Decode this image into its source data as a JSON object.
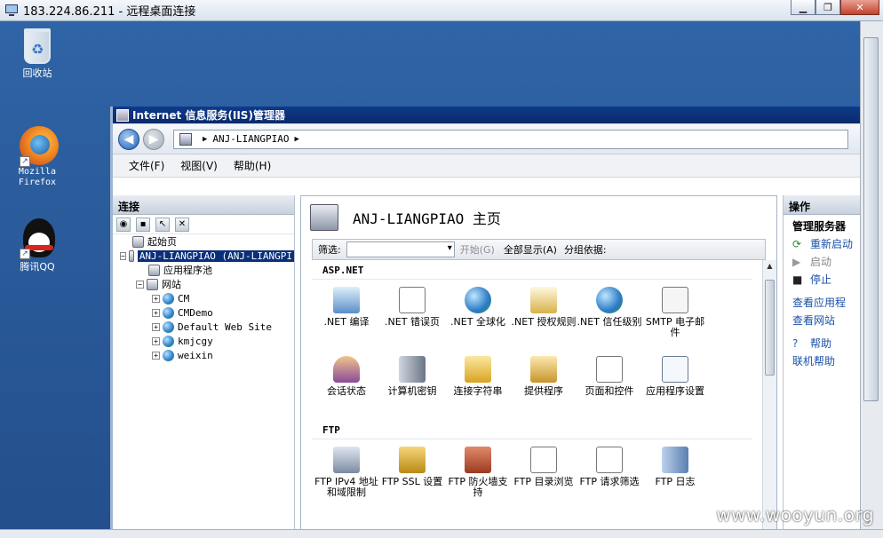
{
  "rdp": {
    "title": "183.224.86.211 - 远程桌面连接"
  },
  "desktop": {
    "icons": [
      {
        "label": "回收站"
      },
      {
        "label": "Mozilla Firefox"
      },
      {
        "label": "腾讯QQ"
      }
    ]
  },
  "iis": {
    "title": "Internet 信息服务(IIS)管理器",
    "address": {
      "server": "ANJ-LIANGPIAO"
    },
    "menu": [
      "文件(F)",
      "视图(V)",
      "帮助(H)"
    ],
    "connections": {
      "header": "连接",
      "tree": [
        {
          "label": "起始页"
        },
        {
          "label": "ANJ-LIANGPIAO (ANJ-LIANGPI"
        },
        {
          "label": "应用程序池"
        },
        {
          "label": "网站"
        },
        {
          "label": "CM"
        },
        {
          "label": "CMDemo"
        },
        {
          "label": "Default Web Site"
        },
        {
          "label": "kmjcgy"
        },
        {
          "label": "weixin"
        }
      ]
    },
    "home": {
      "title": "ANJ-LIANGPIAO 主页",
      "filter": {
        "label": "筛选:",
        "go": "开始(G)",
        "show_all": "全部显示(A)",
        "group_by": "分组依据:"
      },
      "sections": [
        {
          "name": "ASP.NET",
          "items": [
            {
              "label": ".NET 编译",
              "icon": "compile-icon"
            },
            {
              "label": ".NET 错误页",
              "icon": "error-page-icon"
            },
            {
              "label": ".NET 全球化",
              "icon": "globe-icon"
            },
            {
              "label": ".NET 授权规则",
              "icon": "auth-rules-icon"
            },
            {
              "label": ".NET 信任级别",
              "icon": "trust-icon"
            },
            {
              "label": "SMTP 电子邮件",
              "icon": "email-icon"
            },
            {
              "label": "会话状态",
              "icon": "session-icon"
            },
            {
              "label": "计算机密钥",
              "icon": "machine-key-icon"
            },
            {
              "label": "连接字符串",
              "icon": "connection-string-icon"
            },
            {
              "label": "提供程序",
              "icon": "providers-icon"
            },
            {
              "label": "页面和控件",
              "icon": "pages-icon"
            },
            {
              "label": "应用程序设置",
              "icon": "app-settings-icon"
            }
          ]
        },
        {
          "name": "FTP",
          "items": [
            {
              "label": "FTP IPv4 地址和域限制",
              "icon": "ftp-ip-icon"
            },
            {
              "label": "FTP SSL 设置",
              "icon": "ftp-ssl-icon"
            },
            {
              "label": "FTP 防火墙支持",
              "icon": "ftp-firewall-icon"
            },
            {
              "label": "FTP 目录浏览",
              "icon": "ftp-dir-icon"
            },
            {
              "label": "FTP 请求筛选",
              "icon": "ftp-filter-icon"
            },
            {
              "label": "FTP 日志",
              "icon": "ftp-log-icon"
            }
          ]
        }
      ]
    },
    "actions": {
      "header": "操作",
      "group": "管理服务器",
      "items": [
        {
          "label": "重新启动",
          "icon": "restart-icon"
        },
        {
          "label": "启动",
          "icon": "start-icon"
        },
        {
          "label": "停止",
          "icon": "stop-icon"
        },
        {
          "label": "查看应用程",
          "icon": ""
        },
        {
          "label": "查看网站",
          "icon": ""
        },
        {
          "label": "帮助",
          "icon": "help-icon"
        },
        {
          "label": "联机帮助",
          "icon": ""
        }
      ]
    }
  },
  "watermark": "www.wooyun.org"
}
